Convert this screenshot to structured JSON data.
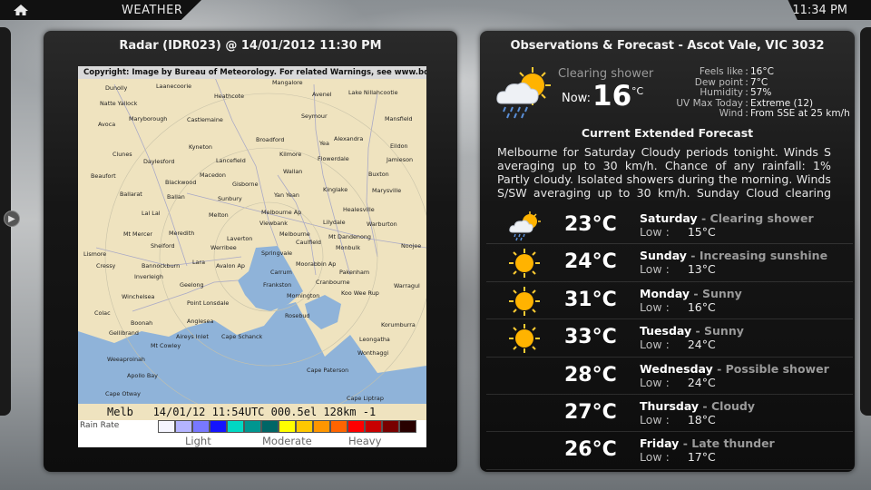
{
  "topbar": {
    "title": "WEATHER",
    "clock": "11:34 PM"
  },
  "radar": {
    "title": "Radar (IDR023) @ 14/01/2012 11:30 PM",
    "copyright": "Copyright: Image by Bureau of Meteorology. For related Warnings, see www.bom.gov.au",
    "stamp": "Melb   14/01/12 11:54UTC 000.5el 128km -1",
    "legend": {
      "title": "Rain Rate",
      "light": "Light",
      "moderate": "Moderate",
      "heavy": "Heavy",
      "colors": [
        "#f5f5ff",
        "#b4b4ff",
        "#7878ff",
        "#1414ff",
        "#00d8c3",
        "#009690",
        "#006666",
        "#ffff00",
        "#ffc800",
        "#ff9600",
        "#ff6400",
        "#ff0000",
        "#c80000",
        "#780000",
        "#280000"
      ]
    },
    "towns": [
      "Dunolly",
      "Laanecoorie",
      "Natte Yallock",
      "Avoca",
      "Maryborough",
      "Heathcote",
      "Mangalore",
      "Avenel",
      "Lake Nillahcootie",
      "Castlemaine",
      "Seymour",
      "Mansfield",
      "Broadford",
      "Yea",
      "Alexandra",
      "Eildon",
      "Clunes",
      "Daylesford",
      "Kyneton",
      "Lancefield",
      "Kilmore",
      "Flowerdale",
      "Jamieson",
      "Beaufort",
      "Blackwood",
      "Macedon",
      "Wallan",
      "Buxton",
      "Ballarat",
      "Gisborne",
      "Kinglake",
      "Marysville",
      "Sunbury",
      "Yan Yean",
      "Healesville",
      "Lal Lal",
      "Melton",
      "Melbourne Ap",
      "Lilydale",
      "Warburton",
      "Viewbank",
      "Mt Mercer",
      "Meredith",
      "Werribee",
      "Laverton",
      "Melbourne",
      "Caulfield",
      "Mt Dandenong",
      "Noojee",
      "Shelford",
      "Springvale",
      "Monbulk",
      "Lismore",
      "Cressy",
      "Bannockburn",
      "Lara",
      "Avalon Ap",
      "Carrum",
      "Moorabbin Ap",
      "Pakenham",
      "Inverleigh",
      "Geelong",
      "Frankston",
      "Cranbourne",
      "Warragul",
      "Winchelsea",
      "Koo Wee Rup",
      "Mornington",
      "Point Lonsdale",
      "Rosebud",
      "Colac",
      "Boonah",
      "Anglesea",
      "Korumburra",
      "Gellibrand",
      "Aireys Inlet",
      "Cape Schanck",
      "Leongatha",
      "Mt Cowley",
      "Wonthaggi",
      "Weeaproinah",
      "Apollo Bay",
      "Cape Paterson",
      "Cape Otway",
      "Cape Liptrap"
    ]
  },
  "observations": {
    "title": "Observations & Forecast - Ascot Vale, VIC 3032",
    "condition": "Clearing shower",
    "now_label": "Now:",
    "temp": "16",
    "temp_unit": "°C",
    "details": [
      {
        "label": "Feels like",
        "value": "16°C"
      },
      {
        "label": "Dew point",
        "value": "7°C"
      },
      {
        "label": "Humidity",
        "value": "57%"
      },
      {
        "label": "UV Max Today",
        "value": "Extreme (12)"
      },
      {
        "label": "Wind",
        "value": "From SSE at 25 km/h"
      }
    ],
    "icon": "cloud-sun-rain-icon"
  },
  "forecast": {
    "heading": "Current Extended Forecast",
    "text": "Melbourne for Saturday Cloudy periods tonight. Winds S averaging up to 30 km/h. Chance of any rainfall: 1% Partly cloudy. Isolated showers during the morning. Winds S/SW averaging up to 30 km/h.   Sunday Cloud clearing during the",
    "low_label": "Low :",
    "days": [
      {
        "day": "Saturday",
        "condition": "Clearing shower",
        "high": "23°C",
        "low": "15°C",
        "icon": "cloud-sun-rain-icon"
      },
      {
        "day": "Sunday",
        "condition": "Increasing sunshine",
        "high": "24°C",
        "low": "13°C",
        "icon": "sun-icon"
      },
      {
        "day": "Monday",
        "condition": "Sunny",
        "high": "31°C",
        "low": "16°C",
        "icon": "sun-icon"
      },
      {
        "day": "Tuesday",
        "condition": "Sunny",
        "high": "33°C",
        "low": "24°C",
        "icon": "sun-icon"
      },
      {
        "day": "Wednesday",
        "condition": "Possible shower",
        "high": "28°C",
        "low": "24°C",
        "icon": ""
      },
      {
        "day": "Thursday",
        "condition": "Cloudy",
        "high": "27°C",
        "low": "18°C",
        "icon": ""
      },
      {
        "day": "Friday",
        "condition": "Late thunder",
        "high": "26°C",
        "low": "17°C",
        "icon": ""
      }
    ]
  }
}
